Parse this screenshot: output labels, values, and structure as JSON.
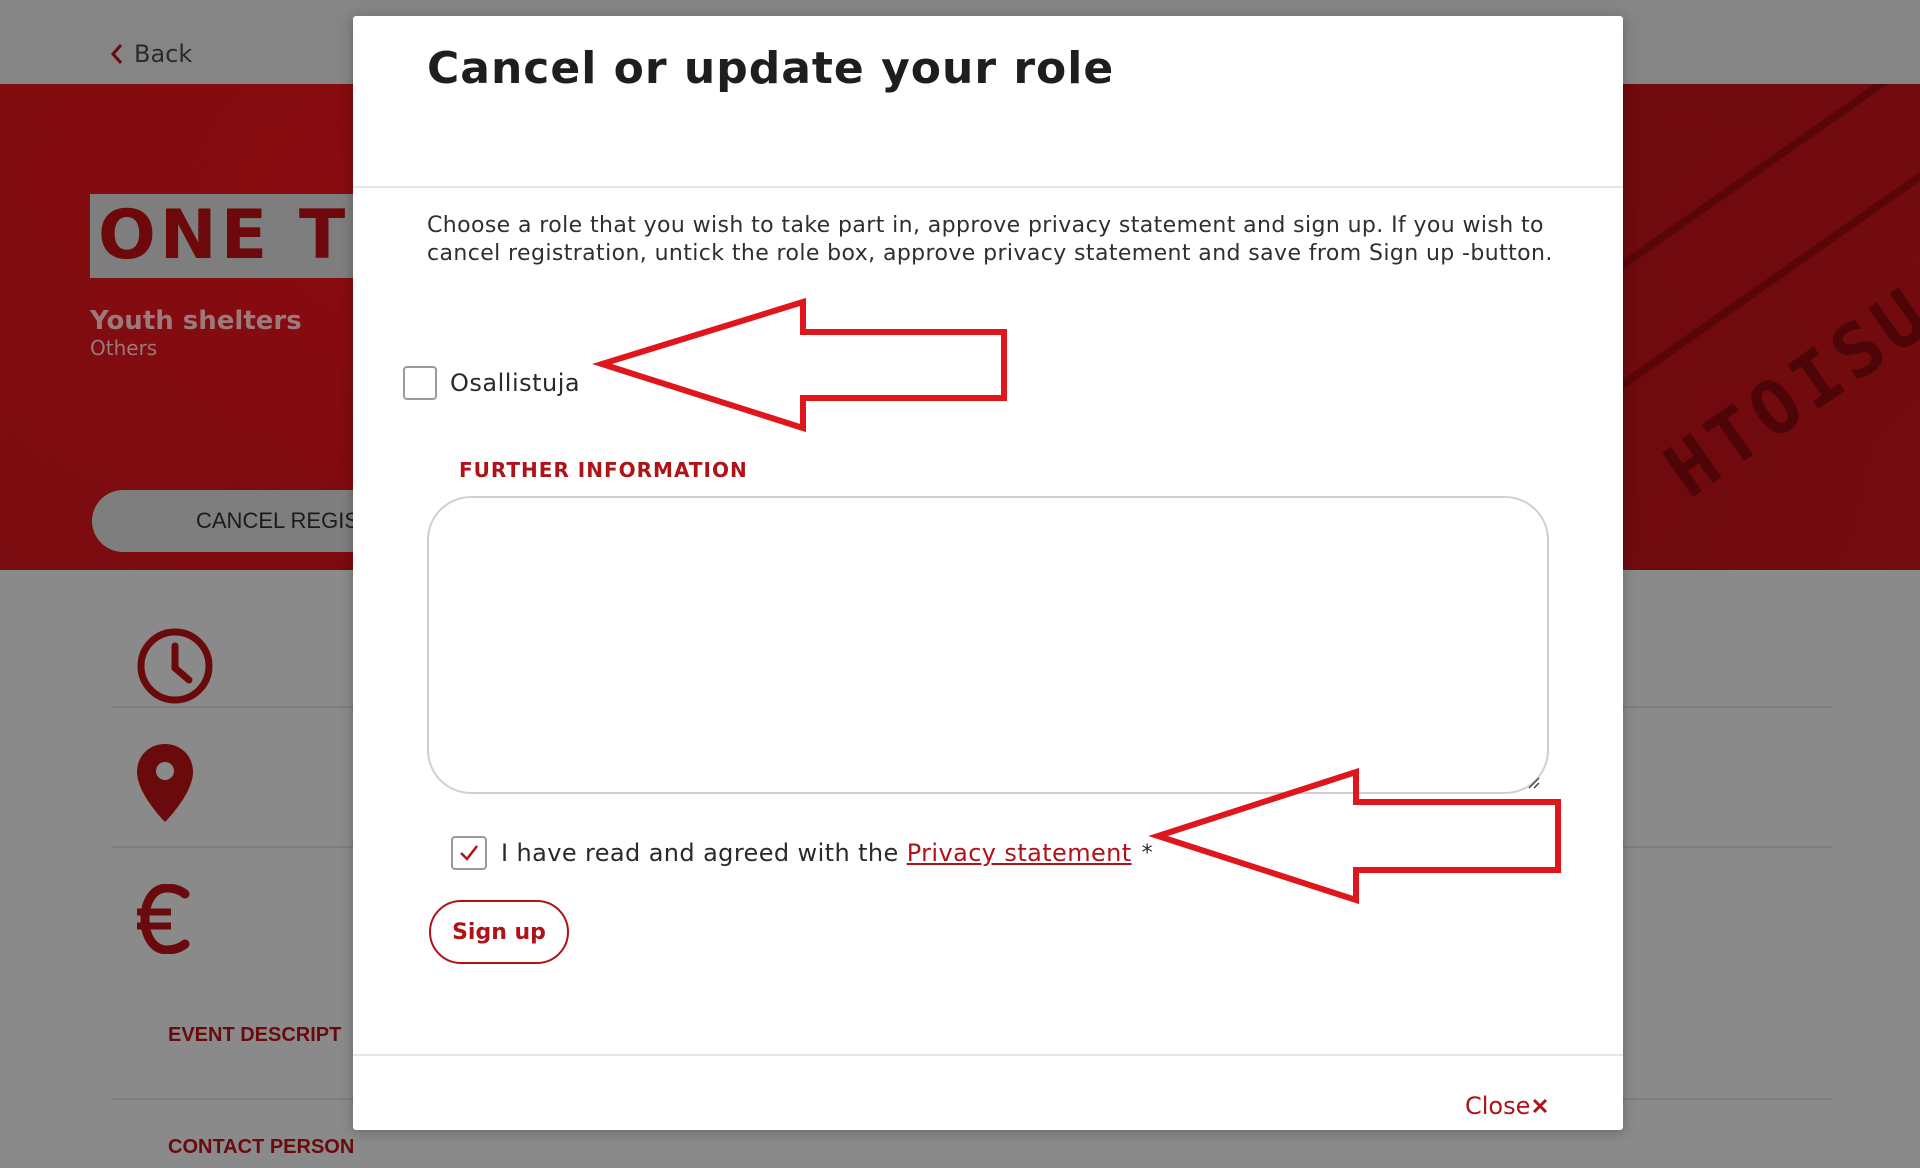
{
  "background": {
    "back_label": "Back",
    "hero_title": "ONE T",
    "hero_subtitle": "Youth shelters",
    "hero_category": "Others",
    "cancel_button": "CANCEL REGIS",
    "stamp_text": "HTOISU",
    "section_event_description": "EVENT DESCRIPT",
    "section_contact_person": "CONTACT PERSON",
    "icons": [
      "clock-icon",
      "location-pin-icon",
      "euro-icon"
    ]
  },
  "modal": {
    "title": "Cancel or update your role",
    "description": "Choose a role that you wish to take part in, approve privacy statement and sign up. If you wish to cancel registration, untick the role box, approve privacy statement and save from Sign up -button.",
    "role": {
      "label": "Osallistuja",
      "checked": false
    },
    "further_info_label": "FURTHER INFORMATION",
    "further_info_value": "",
    "privacy": {
      "checked": true,
      "text": "I have read and agreed with the",
      "link_text": "Privacy statement",
      "required_mark": "*"
    },
    "signup_label": "Sign up",
    "close_label": "Close"
  },
  "annotations": {
    "arrow_color": "#e0161d",
    "arrows": [
      "arrow-to-role-checkbox",
      "arrow-to-privacy-checkbox"
    ]
  },
  "colors": {
    "accent": "#b01217",
    "overlay": "#8a8a8a",
    "hero_red": "#7d0e12"
  }
}
